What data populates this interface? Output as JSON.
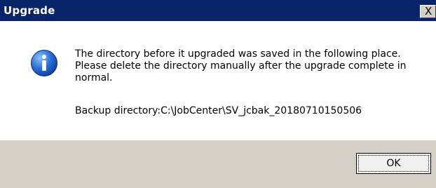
{
  "dialog": {
    "title": "Upgrade",
    "close_label": "X",
    "icon": "info-icon",
    "message_lines": [
      "The directory before it upgraded was saved in the following place.",
      "Please delete the directory manually after the upgrade complete in",
      "normal."
    ],
    "backup_text": "Backup directory:C:\\JobCenter\\SV_jcbak_20180710150506",
    "ok_label": "OK"
  },
  "colors": {
    "titlebar": "#0a246a",
    "footer": "#d4d0c8",
    "icon_blue": "#1f5fbf"
  }
}
